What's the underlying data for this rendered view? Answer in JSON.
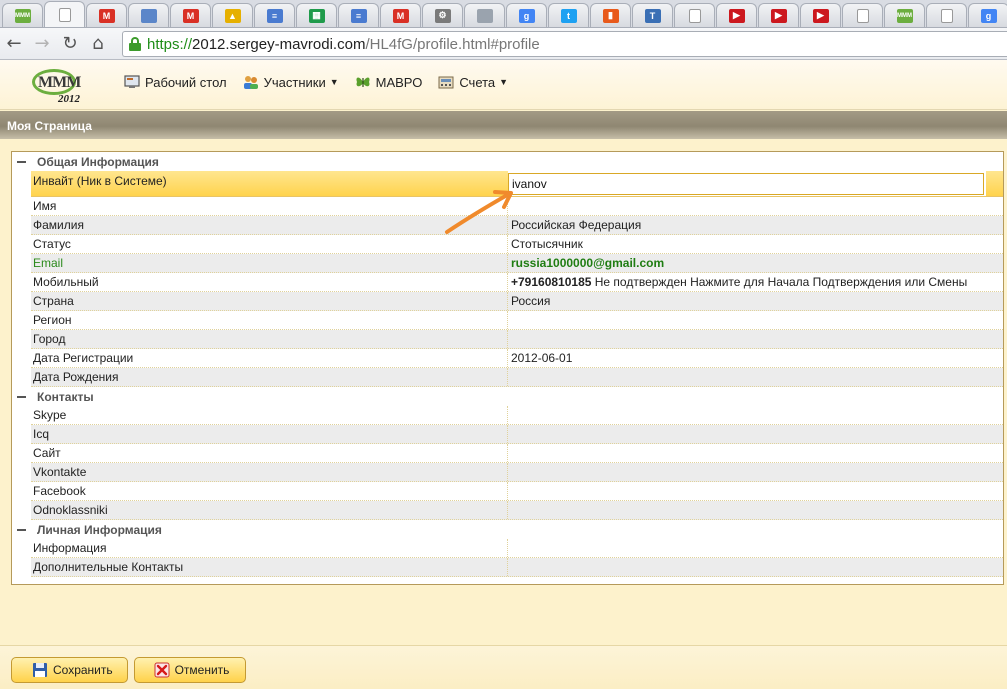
{
  "browser": {
    "tabs": [
      {
        "icon": "mmm-icon",
        "color": "#6cae3f",
        "glyph": "MMM",
        "active": false
      },
      {
        "icon": "page-icon",
        "color": "#ffffff",
        "glyph": "",
        "active": true
      },
      {
        "icon": "gmail-icon",
        "color": "#d93025",
        "glyph": "M",
        "active": false
      },
      {
        "icon": "doc-icon",
        "color": "#5b86c9",
        "glyph": "",
        "active": false
      },
      {
        "icon": "gmail-icon",
        "color": "#d93025",
        "glyph": "M",
        "active": false
      },
      {
        "icon": "drive-icon",
        "color": "#e6b000",
        "glyph": "▲",
        "active": false
      },
      {
        "icon": "docs-icon",
        "color": "#4a7bd0",
        "glyph": "≡",
        "active": false
      },
      {
        "icon": "sheets-icon",
        "color": "#1f9b4b",
        "glyph": "▦",
        "active": false
      },
      {
        "icon": "docs-icon",
        "color": "#4a7bd0",
        "glyph": "≡",
        "active": false
      },
      {
        "icon": "gmail-icon",
        "color": "#d93025",
        "glyph": "M",
        "active": false
      },
      {
        "icon": "gear-icon",
        "color": "#7a7a7a",
        "glyph": "⚙",
        "active": false
      },
      {
        "icon": "image-icon",
        "color": "#9aa3ae",
        "glyph": "",
        "active": false
      },
      {
        "icon": "google-icon",
        "color": "#4285f4",
        "glyph": "g",
        "active": false
      },
      {
        "icon": "twitter-icon",
        "color": "#1da1f2",
        "glyph": "t",
        "active": false
      },
      {
        "icon": "chart-icon",
        "color": "#e85a1b",
        "glyph": "▮",
        "active": false
      },
      {
        "icon": "t-icon",
        "color": "#3a6fb5",
        "glyph": "T",
        "active": false
      },
      {
        "icon": "page-icon",
        "color": "#ffffff",
        "glyph": "",
        "active": false
      },
      {
        "icon": "youtube-icon",
        "color": "#cc181e",
        "glyph": "▶",
        "active": false
      },
      {
        "icon": "youtube-icon",
        "color": "#cc181e",
        "glyph": "▶",
        "active": false
      },
      {
        "icon": "youtube-icon",
        "color": "#cc181e",
        "glyph": "▶",
        "active": false
      },
      {
        "icon": "page-icon",
        "color": "#ffffff",
        "glyph": "",
        "active": false
      },
      {
        "icon": "mmm-icon",
        "color": "#6cae3f",
        "glyph": "MMM",
        "active": false
      },
      {
        "icon": "page-icon",
        "color": "#ffffff",
        "glyph": "",
        "active": false
      },
      {
        "icon": "google-icon",
        "color": "#4285f4",
        "glyph": "g",
        "active": false
      }
    ],
    "url_scheme": "https://",
    "url_host": "2012.sergey-mavrodi.com",
    "url_path": "/HL4fG/profile.html#profile"
  },
  "header": {
    "logo_text": "MMM",
    "logo_year": "2012",
    "menu": {
      "desktop": "Рабочий стол",
      "participants": "Участники",
      "mavro": "МАВРО",
      "accounts": "Счета"
    }
  },
  "panel": {
    "title": "Моя Страница"
  },
  "grid": {
    "general": {
      "title": "Общая Информация",
      "invite_label": "Инвайт (Ник в Системе)",
      "invite_value": "ivanov",
      "rows": [
        {
          "name": "Имя",
          "value": ""
        },
        {
          "name": "Фамилия",
          "value": "Российская Федерация"
        },
        {
          "name": "Статус",
          "value": "Стотысячник"
        },
        {
          "name": "Email",
          "value": "russia1000000@gmail.com"
        },
        {
          "name": "Мобильный",
          "value": "+79160810185",
          "value_extra": " Не подтвержден Нажмите для Начала Подтверждения или Смены"
        },
        {
          "name": "Страна",
          "value": "Россия"
        },
        {
          "name": "Регион",
          "value": ""
        },
        {
          "name": "Город",
          "value": ""
        },
        {
          "name": "Дата Регистрации",
          "value": "2012-06-01"
        },
        {
          "name": "Дата Рождения",
          "value": ""
        }
      ]
    },
    "contacts": {
      "title": "Контакты",
      "rows": [
        {
          "name": "Skype",
          "value": ""
        },
        {
          "name": "Icq",
          "value": ""
        },
        {
          "name": "Сайт",
          "value": ""
        },
        {
          "name": "Vkontakte",
          "value": ""
        },
        {
          "name": "Facebook",
          "value": ""
        },
        {
          "name": "Odnoklassniki",
          "value": ""
        }
      ]
    },
    "personal": {
      "title": "Личная Информация",
      "rows": [
        {
          "name": "Информация",
          "value": ""
        },
        {
          "name": "Дополнительные Контакты",
          "value": ""
        }
      ]
    }
  },
  "footer": {
    "save_label": "Сохранить",
    "cancel_label": "Отменить"
  },
  "colors": {
    "accent_arrow": "#f08a2c",
    "email_green": "#1f7d12"
  }
}
